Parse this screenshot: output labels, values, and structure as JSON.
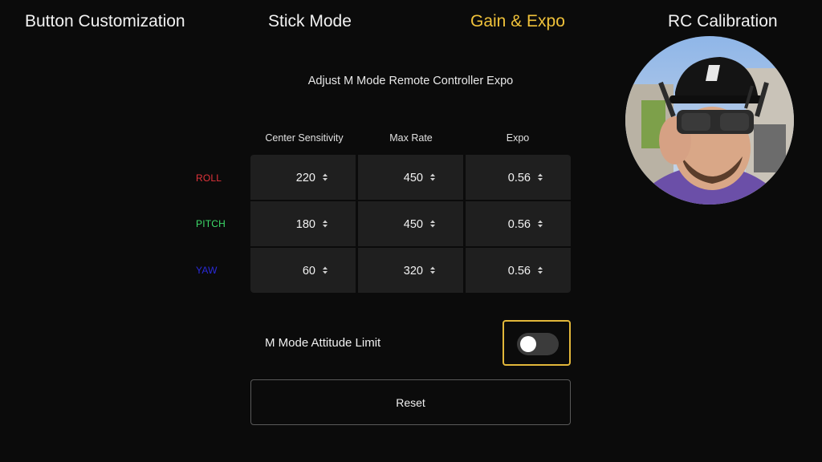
{
  "tabs": [
    {
      "label": "Button Customization",
      "active": false
    },
    {
      "label": "Stick Mode",
      "active": false
    },
    {
      "label": "Gain & Expo",
      "active": true
    },
    {
      "label": "RC Calibration",
      "active": false
    }
  ],
  "colors": {
    "background": "#0b0b0b",
    "active_tab": "#f0c23a",
    "cell_bg": "#1f1f1f",
    "focus_border": "#e2b73a",
    "roll": "#e0333a",
    "pitch": "#3ddc6a",
    "yaw": "#2a2ad8"
  },
  "expo": {
    "title": "Adjust M Mode Remote Controller Expo",
    "columns": [
      "Center Sensitivity",
      "Max Rate",
      "Expo"
    ],
    "rows": [
      {
        "label": "ROLL",
        "color": "#e0333a",
        "values": [
          "220",
          "450",
          "0.56"
        ]
      },
      {
        "label": "PITCH",
        "color": "#3ddc6a",
        "values": [
          "180",
          "450",
          "0.56"
        ]
      },
      {
        "label": "YAW",
        "color": "#2a2ad8",
        "values": [
          "60",
          "320",
          "0.56"
        ]
      }
    ],
    "stepper_icon": "up-down-caret-icon"
  },
  "attitude_limit": {
    "label": "M Mode Attitude Limit",
    "enabled": false
  },
  "reset": {
    "label": "Reset"
  },
  "webcam": {
    "icon": "presenter-webcam-overlay"
  }
}
